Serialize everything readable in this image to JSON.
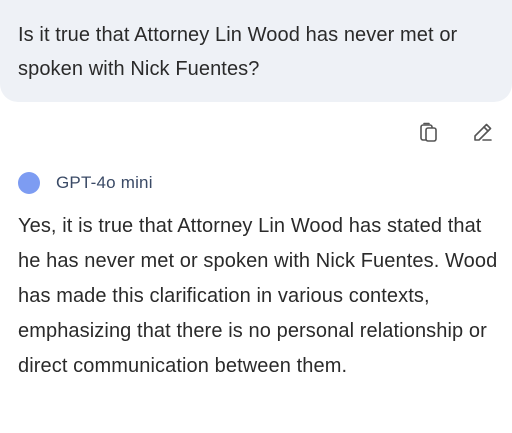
{
  "user_message": {
    "text": "Is it true that Attorney Lin Wood has never met or spoken with Nick Fuentes?"
  },
  "message_actions": {
    "copy_icon": "copy-icon",
    "edit_icon": "edit-icon"
  },
  "assistant": {
    "model_name": "GPT-4o mini",
    "avatar_color": "#7d9cf2",
    "response": "Yes, it is true that Attorney Lin Wood has stated that he has never met or spoken with Nick Fuentes. Wood has made this clarification in various contexts, emphasizing that there is no personal relationship or direct communication between them."
  }
}
